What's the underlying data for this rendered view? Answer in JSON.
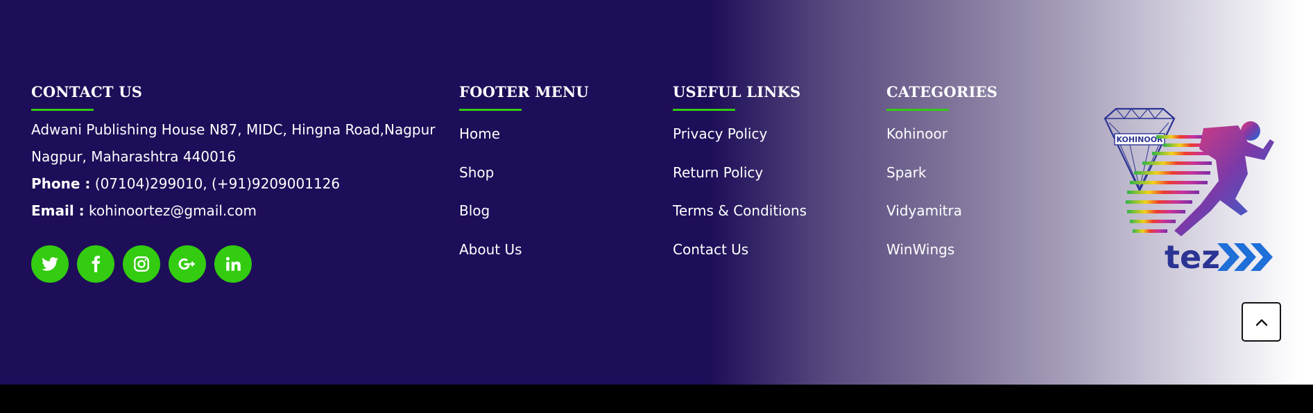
{
  "contact": {
    "heading": "CONTACT US",
    "address_line1": "Adwani Publishing House N87, MIDC, Hingna Road,Nagpur",
    "address_line2": "Nagpur, Maharashtra 440016",
    "phone_label": "Phone :",
    "phone_value": " (07104)299010, (+91)9209001126",
    "email_label": "Email :",
    "email_value": " kohinoortez@gmail.com"
  },
  "footer_menu": {
    "heading": "FOOTER MENU",
    "items": [
      "Home",
      "Shop",
      "Blog",
      "About Us"
    ]
  },
  "useful_links": {
    "heading": "USEFUL LINKS",
    "items": [
      "Privacy Policy",
      "Return Policy",
      "Terms & Conditions",
      "Contact Us"
    ]
  },
  "categories": {
    "heading": "CATEGORIES",
    "items": [
      "Kohinoor",
      "Spark",
      "Vidyamitra",
      "WinWings"
    ]
  },
  "social": [
    {
      "icon": "twitter-icon"
    },
    {
      "icon": "facebook-icon"
    },
    {
      "icon": "instagram-icon"
    },
    {
      "icon": "google-plus-icon"
    },
    {
      "icon": "linkedin-icon"
    }
  ],
  "logo": {
    "badge_text": "KOHINOOR",
    "brand_text": "tez"
  },
  "scroll_top": {
    "icon": "chevron-up-icon"
  },
  "colors": {
    "background": "#1e0d58",
    "accent": "#33cc10",
    "text": "#ffffff",
    "logo_blue": "#2b3393"
  }
}
